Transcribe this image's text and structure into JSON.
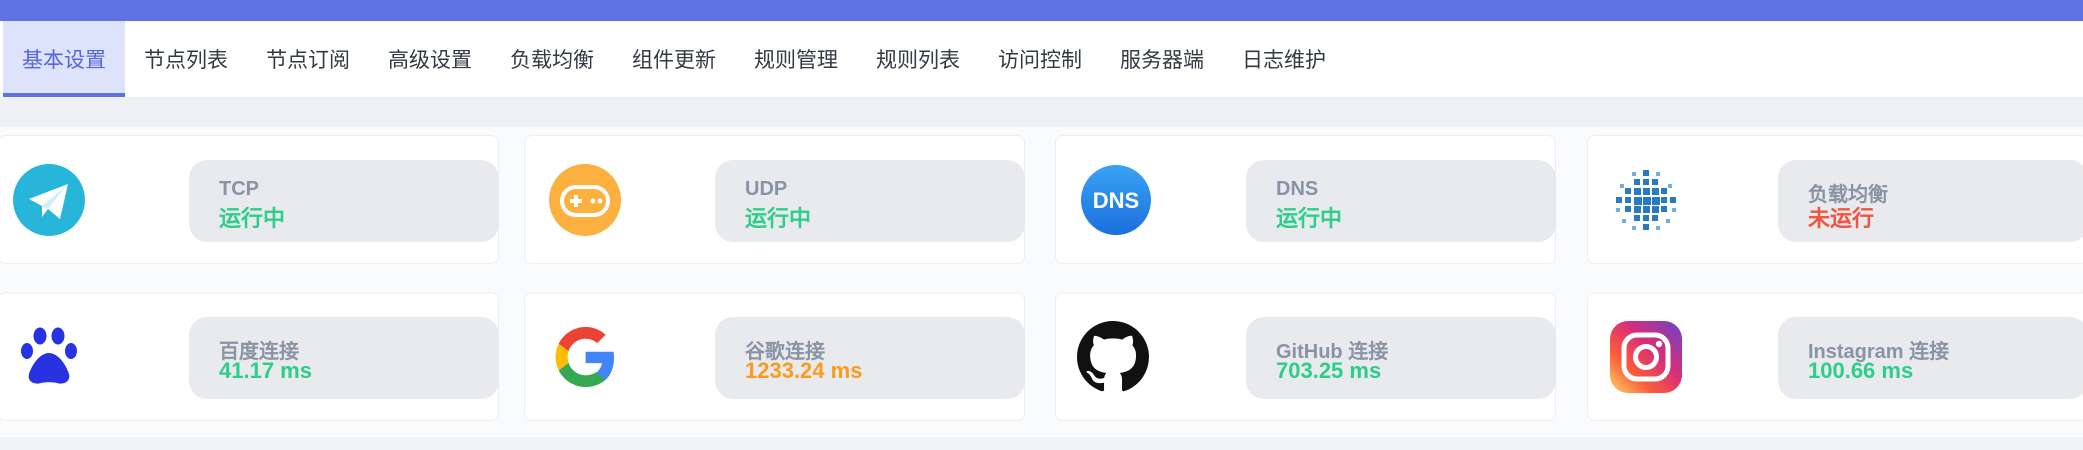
{
  "tabs": [
    {
      "label": "基本设置",
      "active": true
    },
    {
      "label": "节点列表"
    },
    {
      "label": "节点订阅"
    },
    {
      "label": "高级设置"
    },
    {
      "label": "负载均衡"
    },
    {
      "label": "组件更新"
    },
    {
      "label": "规则管理"
    },
    {
      "label": "规则列表"
    },
    {
      "label": "访问控制"
    },
    {
      "label": "服务器端"
    },
    {
      "label": "日志维护"
    }
  ],
  "status": {
    "tcp": {
      "label": "TCP",
      "value": "运行中",
      "icon": "telegram-icon"
    },
    "udp": {
      "label": "UDP",
      "value": "运行中",
      "icon": "gamepad-icon"
    },
    "dns": {
      "label": "DNS",
      "value": "运行中",
      "icon": "dns-icon",
      "icon_text": "DNS"
    },
    "balance": {
      "label": "负载均衡",
      "value": "未运行",
      "icon": "load-balance-icon"
    }
  },
  "latency": {
    "baidu": {
      "label": "百度连接",
      "value": "41.17 ms",
      "icon": "baidu-paw-icon"
    },
    "google": {
      "label": "谷歌连接",
      "value": "1233.24 ms",
      "icon": "google-icon"
    },
    "github": {
      "label": "GitHub 连接",
      "value": "703.25 ms",
      "icon": "github-icon"
    },
    "instagram": {
      "label": "Instagram 连接",
      "value": "100.66 ms",
      "icon": "instagram-icon"
    }
  },
  "colors": {
    "accent": "#5f72e4",
    "running": "#2dce89",
    "stopped": "#f5533d",
    "slow": "#fb9b1e"
  }
}
